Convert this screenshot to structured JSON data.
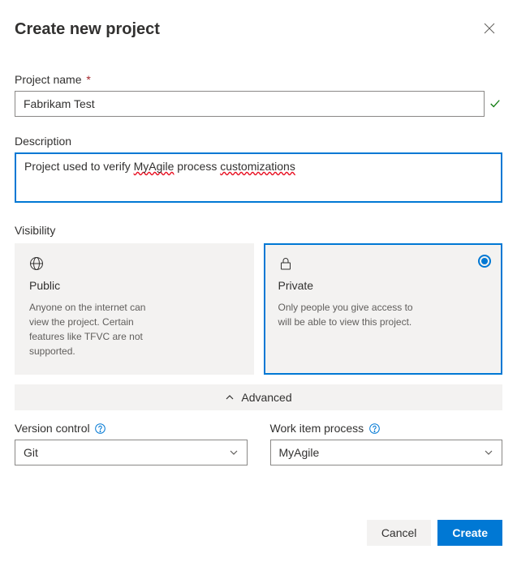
{
  "header": {
    "title": "Create new project"
  },
  "project_name": {
    "label": "Project name",
    "required_marker": "*",
    "value": "Fabrikam Test"
  },
  "description": {
    "label": "Description",
    "value_parts": {
      "pre": "Project used to verify ",
      "err1": "MyAgile",
      "mid": " process ",
      "err2": "customizations"
    }
  },
  "visibility": {
    "label": "Visibility",
    "options": [
      {
        "key": "public",
        "title": "Public",
        "desc": "Anyone on the internet can view the project. Certain features like TFVC are not supported.",
        "selected": false
      },
      {
        "key": "private",
        "title": "Private",
        "desc": "Only people you give access to will be able to view this project.",
        "selected": true
      }
    ]
  },
  "advanced": {
    "toggle_label": "Advanced",
    "version_control": {
      "label": "Version control",
      "value": "Git"
    },
    "work_item_process": {
      "label": "Work item process",
      "value": "MyAgile"
    }
  },
  "footer": {
    "cancel": "Cancel",
    "create": "Create"
  }
}
